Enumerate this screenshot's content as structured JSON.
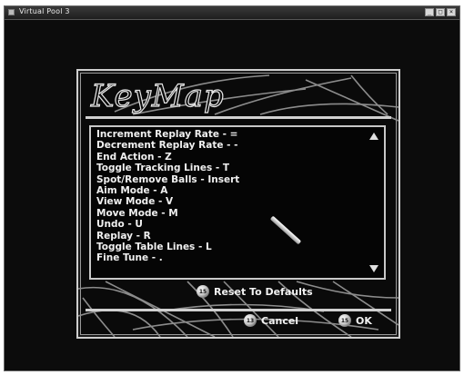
{
  "window": {
    "title": "Virtual Pool 3",
    "controls": [
      "_",
      "□",
      "×"
    ]
  },
  "panel": {
    "title": "KeyMap",
    "keymap_items": [
      "Increment Replay Rate - =",
      "Decrement Replay Rate - -",
      "End Action - Z",
      "Toggle Tracking Lines - T",
      "Spot/Remove Balls - Insert",
      "Aim Mode - A",
      "View Mode - V",
      "Move Mode - M",
      "Undo - U",
      "Replay - R",
      "Toggle Table Lines - L",
      "Fine Tune - ."
    ]
  },
  "buttons": {
    "reset": {
      "label": "Reset To Defaults",
      "ball": "15"
    },
    "cancel": {
      "label": "Cancel",
      "ball": "13"
    },
    "ok": {
      "label": "OK",
      "ball": "15"
    }
  }
}
